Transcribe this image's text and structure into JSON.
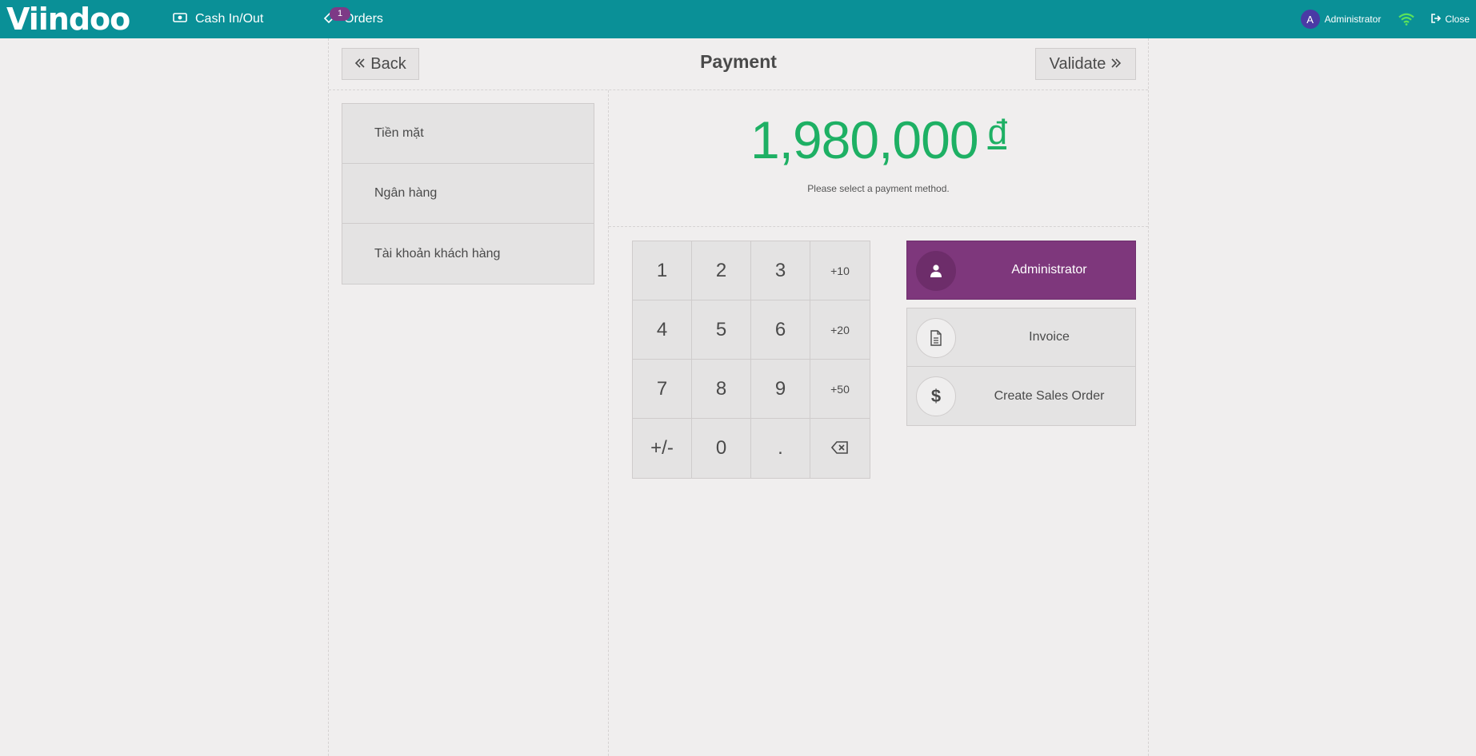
{
  "topbar": {
    "logo": "Viindoo",
    "cash_label": "Cash In/Out",
    "orders_label": "Orders",
    "orders_badge": "1",
    "user_initial": "A",
    "user_name": "Administrator",
    "close_label": "Close"
  },
  "header": {
    "back_label": "Back",
    "title": "Payment",
    "validate_label": "Validate"
  },
  "payment_methods": [
    {
      "label": "Tiền mặt"
    },
    {
      "label": "Ngân hàng"
    },
    {
      "label": "Tài khoản khách hàng"
    }
  ],
  "due": {
    "amount": "1,980,000",
    "currency": "đ",
    "message": "Please select a payment method."
  },
  "numpad": [
    "1",
    "2",
    "3",
    "+10",
    "4",
    "5",
    "6",
    "+20",
    "7",
    "8",
    "9",
    "+50",
    "+/-",
    "0",
    "."
  ],
  "actions": {
    "client": "Administrator",
    "invoice": "Invoice",
    "sales_order": "Create Sales Order"
  },
  "colors": {
    "topbar": "#0a9097",
    "due_amount": "#1eb064",
    "client_button": "#7e377c"
  }
}
